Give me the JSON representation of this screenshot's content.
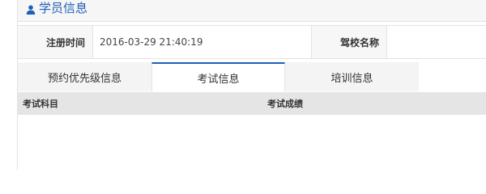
{
  "header": {
    "title": "学员信息",
    "icon": "user-icon",
    "title_color": "#1f5fb5"
  },
  "info": {
    "reg_time_label": "注册时间",
    "reg_time_value": "2016-03-29 21:40:19",
    "school_label": "驾校名称",
    "school_value": ""
  },
  "tabs": [
    {
      "label": "预约优先级信息",
      "active": false
    },
    {
      "label": "考试信息",
      "active": true
    },
    {
      "label": "培训信息",
      "active": false
    }
  ],
  "grid": {
    "columns": [
      "考试科目",
      "考试成绩"
    ]
  },
  "accent_color": "#1f5fb5"
}
